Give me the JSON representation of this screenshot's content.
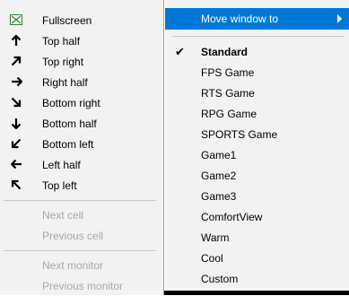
{
  "left_menu": {
    "items": [
      {
        "label": "Fullscreen",
        "icon": "fullscreen-icon"
      },
      {
        "label": "Top half",
        "icon": "arrow-up-icon"
      },
      {
        "label": "Top right",
        "icon": "arrow-up-right-icon"
      },
      {
        "label": "Right half",
        "icon": "arrow-right-icon"
      },
      {
        "label": "Bottom right",
        "icon": "arrow-down-right-icon"
      },
      {
        "label": "Bottom half",
        "icon": "arrow-down-icon"
      },
      {
        "label": "Bottom left",
        "icon": "arrow-down-left-icon"
      },
      {
        "label": "Left half",
        "icon": "arrow-left-icon"
      },
      {
        "label": "Top left",
        "icon": "arrow-up-left-icon"
      }
    ],
    "disabled_items": [
      {
        "label": "Next cell"
      },
      {
        "label": "Previous cell"
      },
      {
        "label": "Next monitor"
      },
      {
        "label": "Previous monitor"
      }
    ]
  },
  "right_menu": {
    "header": {
      "label": "Move window to"
    },
    "items": [
      {
        "label": "Standard",
        "checked": true
      },
      {
        "label": "FPS Game"
      },
      {
        "label": "RTS Game"
      },
      {
        "label": "RPG Game"
      },
      {
        "label": "SPORTS Game"
      },
      {
        "label": "Game1"
      },
      {
        "label": "Game2"
      },
      {
        "label": "Game3"
      },
      {
        "label": "ComfortView"
      },
      {
        "label": "Warm"
      },
      {
        "label": "Cool"
      },
      {
        "label": "Custom"
      }
    ]
  },
  "colors": {
    "menu_bg": "#f2f2f2",
    "highlight": "#0078d7",
    "disabled_text": "#a7a7a7"
  }
}
